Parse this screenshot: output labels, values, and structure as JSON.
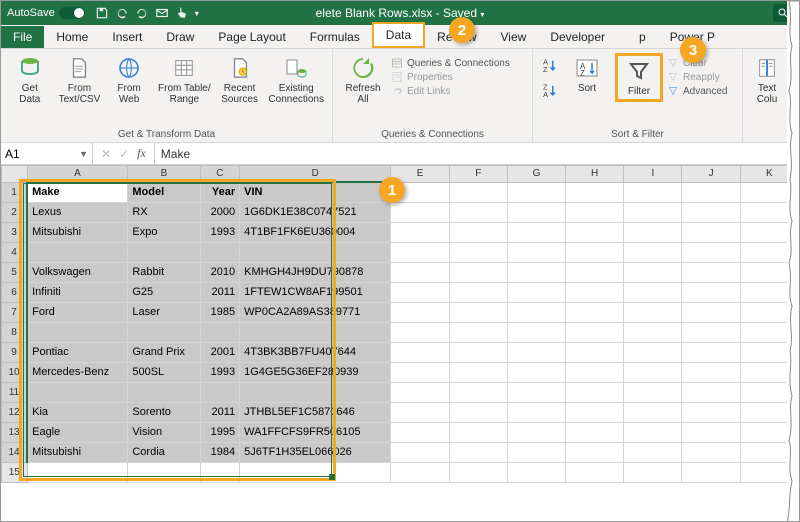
{
  "title": {
    "autosave_label": "AutoSave",
    "autosave_pill": "On",
    "file": "elete Blank Rows.xlsx",
    "state": "Saved"
  },
  "tabs": {
    "file": "File",
    "home": "Home",
    "insert": "Insert",
    "draw": "Draw",
    "page_layout": "Page Layout",
    "formulas": "Formulas",
    "data": "Data",
    "review": "Review",
    "view": "View",
    "developer": "Developer",
    "tail": "p",
    "power": "Power P"
  },
  "ribbon": {
    "get_data": {
      "label": "Get\nData"
    },
    "from_textcsv": {
      "label": "From\nText/CSV"
    },
    "from_web": {
      "label": "From\nWeb"
    },
    "from_table": {
      "label": "From Table/\nRange"
    },
    "recent": {
      "label": "Recent\nSources"
    },
    "existing": {
      "label": "Existing\nConnections"
    },
    "group1_label": "Get & Transform Data",
    "refresh": {
      "label": "Refresh\nAll"
    },
    "qc": {
      "a": "Queries & Connections",
      "b": "Properties",
      "c": "Edit Links"
    },
    "group2_label": "Queries & Connections",
    "sort_az": {
      "a": "A",
      "z": "Z"
    },
    "sort": {
      "label": "Sort"
    },
    "filter": {
      "label": "Filter"
    },
    "sf": {
      "clear": "Clear",
      "reapply": "Reapply",
      "advanced": "Advanced"
    },
    "group3_label": "Sort & Filter",
    "text_cols": {
      "label": "Text\nColu"
    }
  },
  "formula_bar": {
    "name_box": "A1",
    "fx": "fx",
    "value": "Make"
  },
  "columns": [
    "A",
    "B",
    "C",
    "D",
    "E",
    "F",
    "G",
    "H",
    "I",
    "J",
    "K"
  ],
  "rows": [
    {
      "n": "1",
      "a": "Make",
      "b": "Model",
      "c": "Year",
      "d": "VIN",
      "hdr": true,
      "active": true
    },
    {
      "n": "2",
      "a": "Lexus",
      "b": "RX",
      "c": "2000",
      "d": "1G6DK1E38C0747521"
    },
    {
      "n": "3",
      "a": "Mitsubishi",
      "b": "Expo",
      "c": "1993",
      "d": "4T1BF1FK6EU360004"
    },
    {
      "n": "4",
      "a": "",
      "b": "",
      "c": "",
      "d": ""
    },
    {
      "n": "5",
      "a": "Volkswagen",
      "b": "Rabbit",
      "c": "2010",
      "d": "KMHGH4JH9DU790878"
    },
    {
      "n": "6",
      "a": "Infiniti",
      "b": "G25",
      "c": "2011",
      "d": "1FTEW1CW8AF199501"
    },
    {
      "n": "7",
      "a": "Ford",
      "b": "Laser",
      "c": "1985",
      "d": "WP0CA2A89AS389771"
    },
    {
      "n": "8",
      "a": "",
      "b": "",
      "c": "",
      "d": ""
    },
    {
      "n": "9",
      "a": "Pontiac",
      "b": "Grand Prix",
      "c": "2001",
      "d": "4T3BK3BB7FU407644"
    },
    {
      "n": "10",
      "a": "Mercedes-Benz",
      "b": "500SL",
      "c": "1993",
      "d": "1G4GE5G36EF280939"
    },
    {
      "n": "11",
      "a": "",
      "b": "",
      "c": "",
      "d": ""
    },
    {
      "n": "12",
      "a": "Kia",
      "b": "Sorento",
      "c": "2011",
      "d": "JTHBL5EF1C5870646"
    },
    {
      "n": "13",
      "a": "Eagle",
      "b": "Vision",
      "c": "1995",
      "d": "WA1FFCFS9FR506105"
    },
    {
      "n": "14",
      "a": "Mitsubishi",
      "b": "Cordia",
      "c": "1984",
      "d": "5J6TF1H35EL066026"
    },
    {
      "n": "15",
      "a": "",
      "b": "",
      "c": "",
      "d": "",
      "unsel": true
    }
  ],
  "callouts": {
    "1": "1",
    "2": "2",
    "3": "3"
  }
}
